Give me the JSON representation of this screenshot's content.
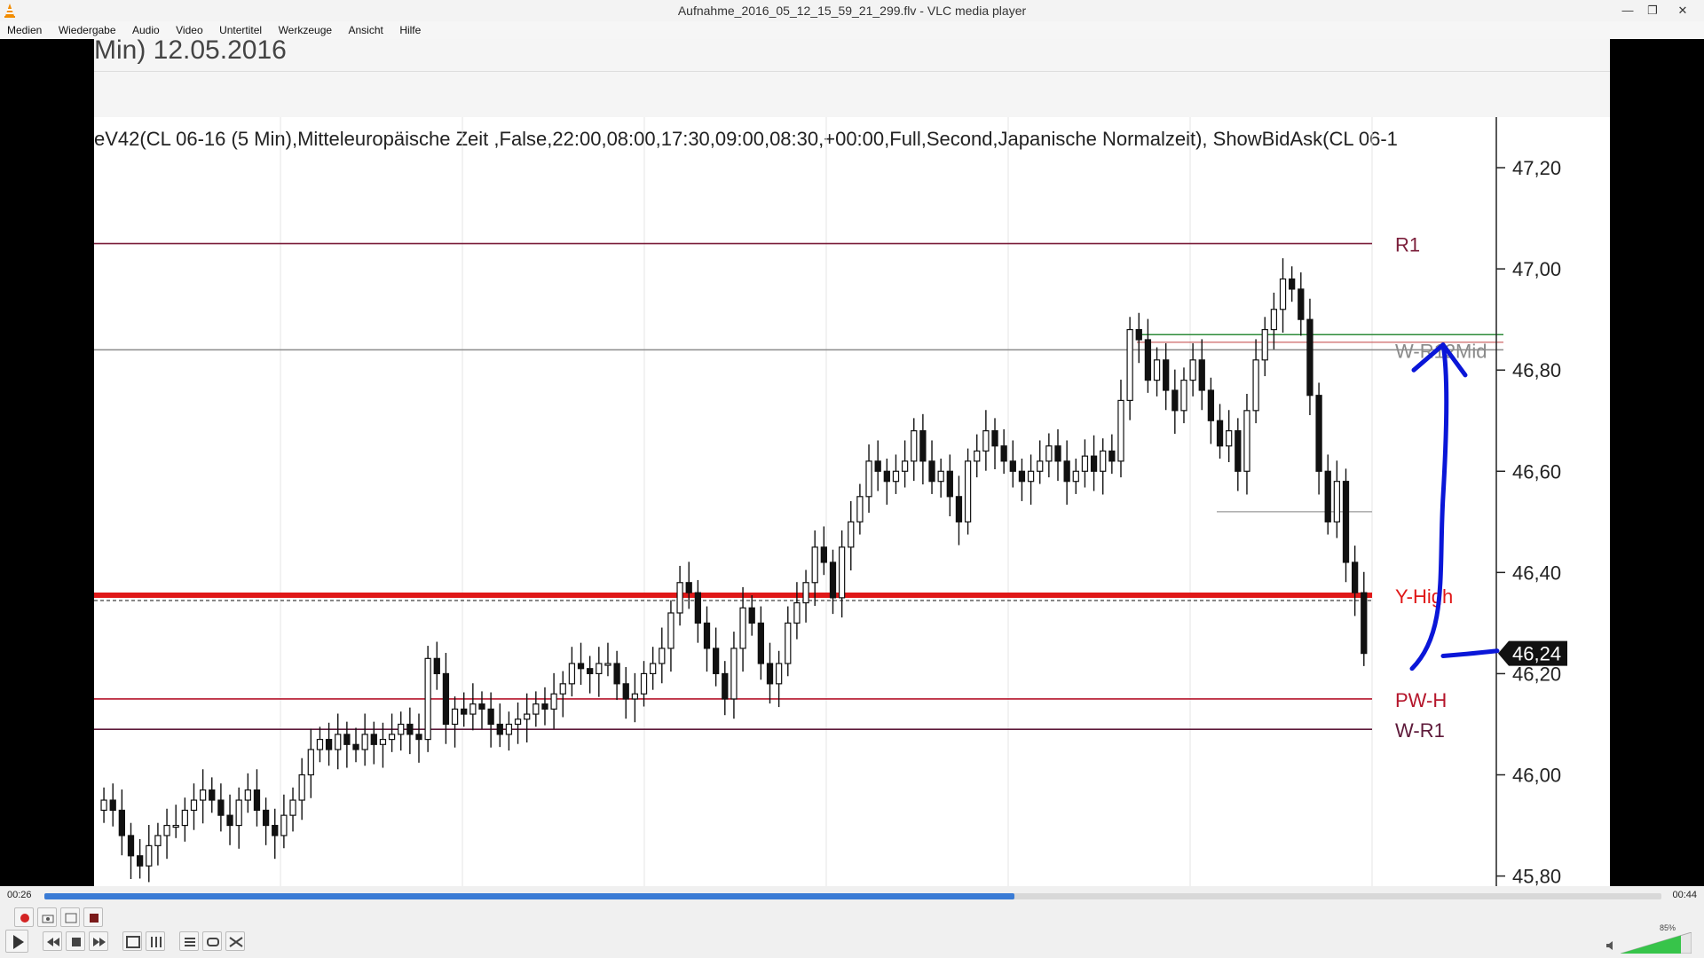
{
  "window": {
    "title": "Aufnahme_2016_05_12_15_59_21_299.flv - VLC media player"
  },
  "menu": [
    "Medien",
    "Wiedergabe",
    "Audio",
    "Video",
    "Untertitel",
    "Werkzeuge",
    "Ansicht",
    "Hilfe"
  ],
  "video": {
    "header_text": "Min)  12.05.2016",
    "indicator_text": "eV42(CL 06-16 (5 Min),Mitteleuropäische Zeit ,False,22:00,08:00,17:30,09:00,08:30,+00:00,Full,Second,Japanische Normalzeit), ShowBidAsk(CL 06-1"
  },
  "chart_data": {
    "type": "candlestick",
    "y_axis_ticks": [
      "47,20",
      "47,00",
      "46,80",
      "46,60",
      "46,40",
      "46,20",
      "46,00",
      "45,80"
    ],
    "ylim": [
      45.78,
      47.3
    ],
    "current_price_label": "46,24",
    "current_price": 46.24,
    "levels": [
      {
        "name": "R1",
        "value": 47.05,
        "color": "#7b1e3a"
      },
      {
        "name": "W-R12Mid",
        "value": 46.84,
        "color": "#8a8a8a"
      },
      {
        "name": "Y-High",
        "value": 46.355,
        "color": "#e01818"
      },
      {
        "name": "PW-H",
        "value": 46.15,
        "color": "#b5152b"
      },
      {
        "name": "W-R1",
        "value": 46.09,
        "color": "#5e1a3a"
      }
    ],
    "candles_close": [
      45.95,
      45.93,
      45.88,
      45.84,
      45.82,
      45.86,
      45.88,
      45.9,
      45.9,
      45.93,
      45.95,
      45.97,
      45.95,
      45.92,
      45.9,
      45.95,
      45.97,
      45.93,
      45.9,
      45.88,
      45.92,
      45.95,
      46.0,
      46.05,
      46.07,
      46.05,
      46.08,
      46.06,
      46.05,
      46.08,
      46.06,
      46.07,
      46.08,
      46.1,
      46.08,
      46.07,
      46.23,
      46.2,
      46.1,
      46.13,
      46.12,
      46.14,
      46.13,
      46.1,
      46.08,
      46.1,
      46.11,
      46.12,
      46.14,
      46.13,
      46.16,
      46.18,
      46.22,
      46.21,
      46.2,
      46.22,
      46.22,
      46.18,
      46.15,
      46.16,
      46.2,
      46.22,
      46.25,
      46.32,
      46.38,
      46.36,
      46.3,
      46.25,
      46.2,
      46.15,
      46.25,
      46.33,
      46.3,
      46.22,
      46.18,
      46.22,
      46.3,
      46.34,
      46.38,
      46.45,
      46.42,
      46.35,
      46.45,
      46.5,
      46.55,
      46.62,
      46.6,
      46.58,
      46.6,
      46.62,
      46.68,
      46.62,
      46.58,
      46.6,
      46.55,
      46.5,
      46.62,
      46.64,
      46.68,
      46.65,
      46.62,
      46.6,
      46.58,
      46.6,
      46.62,
      46.65,
      46.62,
      46.58,
      46.6,
      46.63,
      46.6,
      46.64,
      46.62,
      46.74,
      46.88,
      46.86,
      46.78,
      46.82,
      46.76,
      46.72,
      46.78,
      46.82,
      46.76,
      46.7,
      46.65,
      46.68,
      46.6,
      46.72,
      46.82,
      46.88,
      46.92,
      46.98,
      46.96,
      46.9,
      46.75,
      46.6,
      46.5,
      46.58,
      46.42,
      46.36,
      46.24
    ],
    "annotations": [
      {
        "type": "hand-drawn-arrow",
        "color": "#0a16d8"
      },
      {
        "type": "hand-drawn-line",
        "color": "#0a16d8"
      }
    ]
  },
  "controls": {
    "time_elapsed": "00:26",
    "time_total": "00:44",
    "progress": 0.6,
    "volume_label": "85%",
    "volume": 0.85
  }
}
